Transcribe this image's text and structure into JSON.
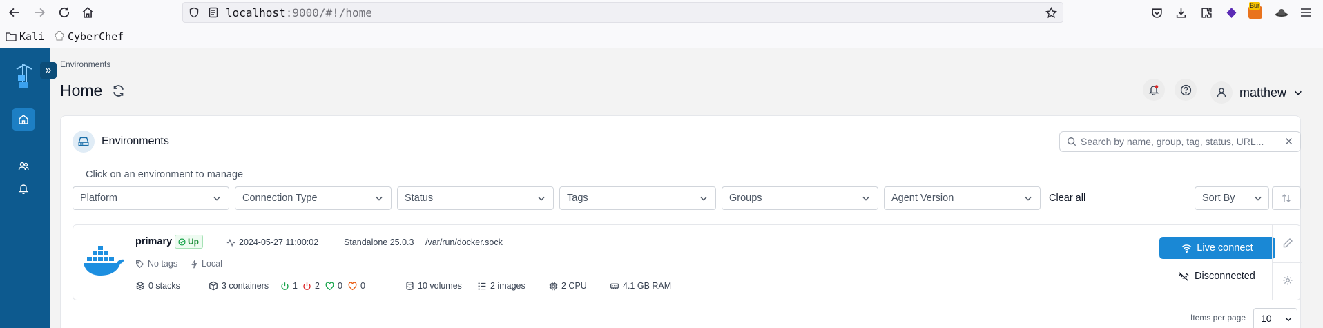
{
  "browser": {
    "url_host": "localhost",
    "url_rest": ":9000/#!/home",
    "bookmarks": [
      {
        "label": "Kali"
      },
      {
        "label": "CyberChef"
      }
    ],
    "burp_badge": "Bur"
  },
  "breadcrumb": "Environments",
  "page_title": "Home",
  "user": {
    "name": "matthew"
  },
  "panel": {
    "title": "Environments",
    "search_placeholder": "Search by name, group, tag, status, URL...",
    "hint": "Click on an environment to manage"
  },
  "filters": [
    {
      "label": "Platform"
    },
    {
      "label": "Connection Type"
    },
    {
      "label": "Status"
    },
    {
      "label": "Tags"
    },
    {
      "label": "Groups"
    },
    {
      "label": "Agent Version"
    }
  ],
  "clear_all": "Clear all",
  "sort_by": "Sort By",
  "environment": {
    "name": "primary",
    "status": "Up",
    "timestamp": "2024-05-27 11:00:02",
    "type": "Standalone 25.0.3",
    "url": "/var/run/docker.sock",
    "tags": "No tags",
    "location": "Local",
    "stacks": "0 stacks",
    "containers": "3 containers",
    "running": "1",
    "stopped": "2",
    "healthy": "0",
    "unhealthy": "0",
    "volumes": "10 volumes",
    "images": "2 images",
    "cpu": "2 CPU",
    "ram": "4.1 GB RAM",
    "live_connect": "Live connect",
    "connection_status": "Disconnected"
  },
  "pagination": {
    "label": "Items per page",
    "value": "10"
  },
  "colors": {
    "sidebar": "#0d5a8f",
    "accent": "#1a88d5",
    "up": "#16a34a"
  }
}
